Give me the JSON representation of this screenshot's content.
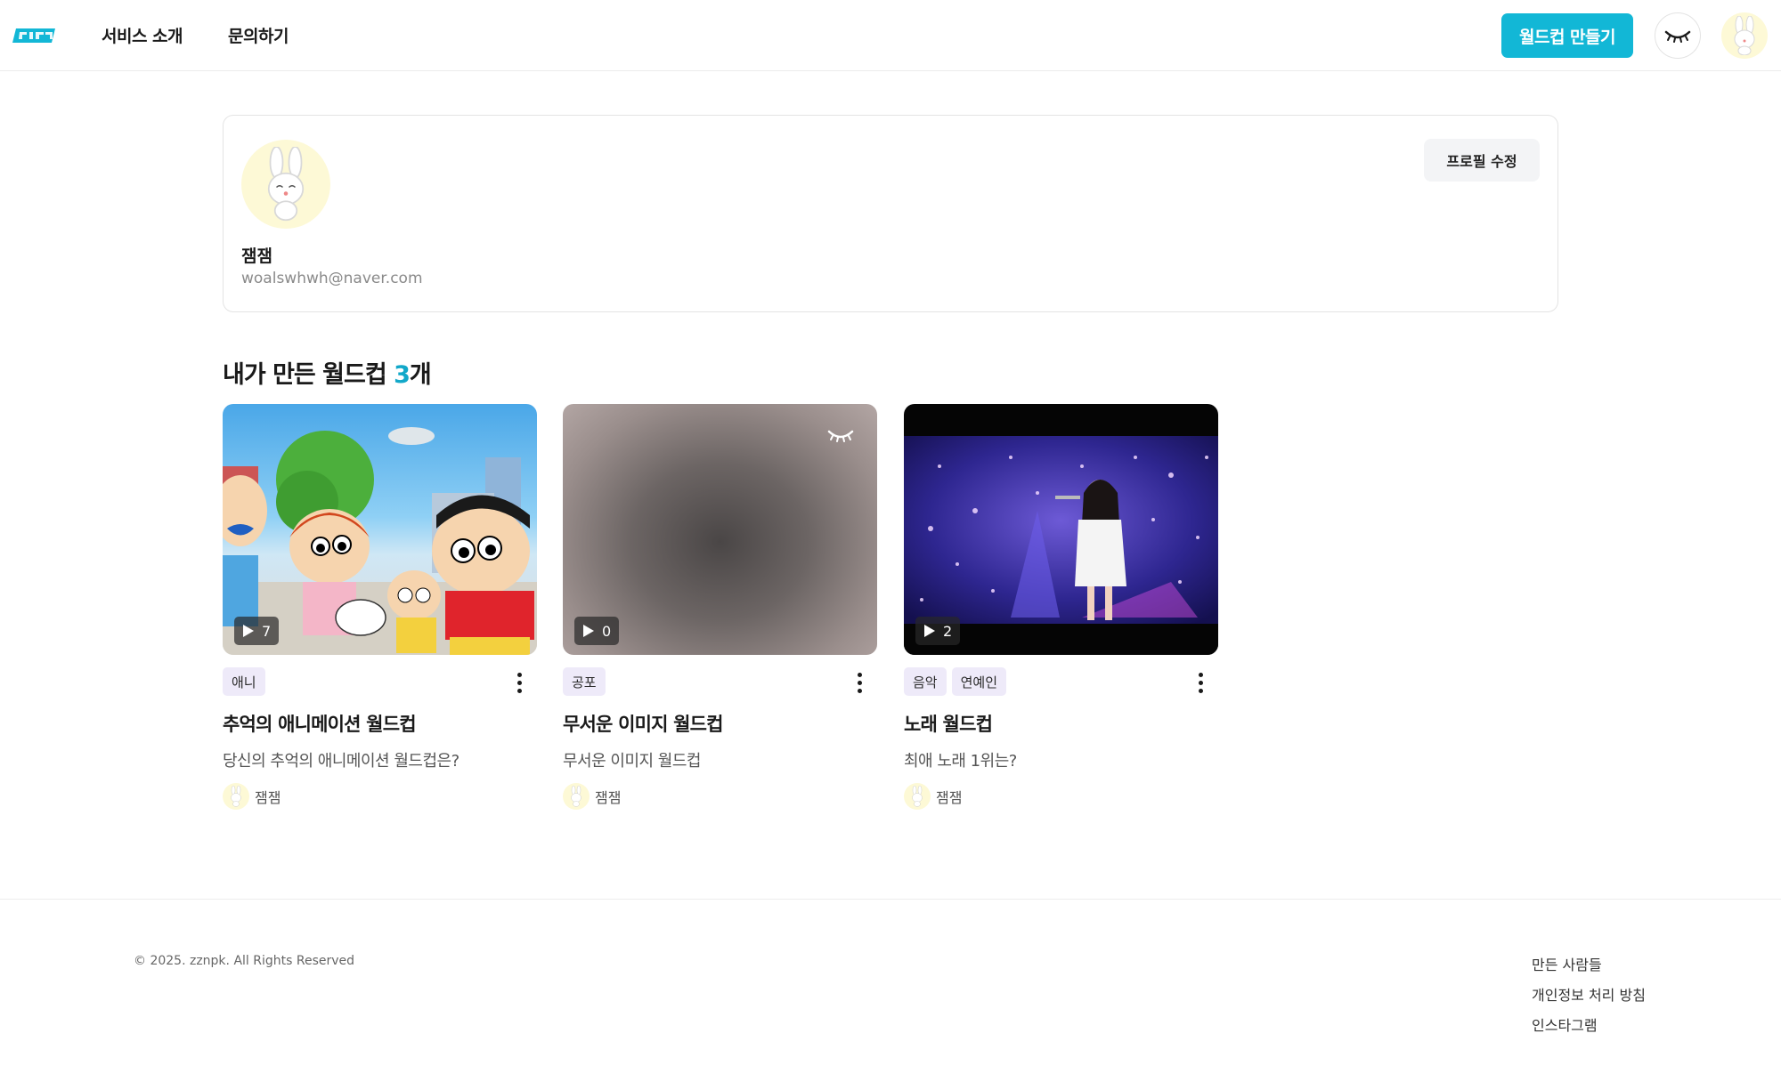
{
  "header": {
    "logo_alt": "짬픽",
    "nav": [
      {
        "label": "서비스 소개"
      },
      {
        "label": "문의하기"
      }
    ],
    "create_button": "월드컵 만들기",
    "theme_icon": "closed-eye-icon",
    "accent_color": "#12b7d6"
  },
  "profile": {
    "name": "잼잼",
    "email": "woalswhwh@naver.com",
    "edit_button": "프로필 수정"
  },
  "section": {
    "title_prefix": "내가 만든 월드컵 ",
    "count": "3",
    "title_suffix": "개"
  },
  "cards": [
    {
      "tags": [
        "애니"
      ],
      "play_count": "7",
      "title": "추억의 애니메이션 월드컵",
      "description": "당신의 추억의 애니메이션 월드컵은?",
      "author": "잼잼"
    },
    {
      "tags": [
        "공포"
      ],
      "play_count": "0",
      "title": "무서운 이미지 월드컵",
      "description": "무서운 이미지 월드컵",
      "author": "잼잼",
      "blurred": true
    },
    {
      "tags": [
        "음악",
        "연예인"
      ],
      "play_count": "2",
      "title": "노래 월드컵",
      "description": "최애 노래 1위는?",
      "author": "잼잼"
    }
  ],
  "footer": {
    "copyright": "© 2025. zznpk. All Rights Reserved",
    "links": [
      "만든 사람들",
      "개인정보 처리 방침",
      "인스타그램"
    ]
  }
}
